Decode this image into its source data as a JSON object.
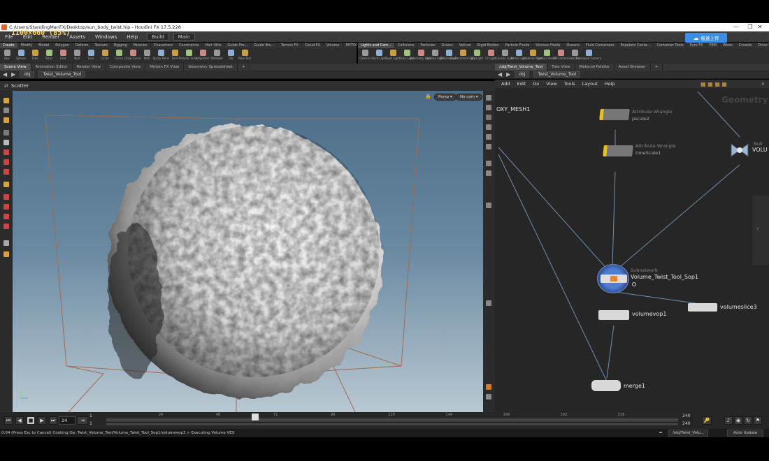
{
  "window": {
    "title": "C:/Users/StandingManFX/Desktop/sun_body_twist.hip - Houdini FX 17.5.228",
    "controls": [
      "—",
      "❐",
      "✕"
    ]
  },
  "overlay": {
    "size_label": "1100×660 (85%)"
  },
  "menubar": {
    "items": [
      "File",
      "Edit",
      "Render",
      "Assets",
      "Windows",
      "Help"
    ],
    "desktop_build": "Build",
    "desktop_main": "Main"
  },
  "cloud_button": {
    "label": "极速上传"
  },
  "shelf_left": {
    "tabs": [
      "Create",
      "Modify",
      "Model",
      "Polygon",
      "Deform",
      "Texture",
      "Rigging",
      "Muscles",
      "Characters",
      "Constraints",
      "Hair Utils",
      "Guide Pro...",
      "Guide Bru...",
      "Terrain FX",
      "Cloud FX",
      "Volume",
      "MYTOOLKIT"
    ],
    "tools": [
      "Box",
      "Sphere",
      "Tube",
      "Torus",
      "Grid",
      "Null",
      "Line",
      "Circle",
      "Curve",
      "Draw Curve",
      "Path",
      "Spray Paint",
      "Font",
      "Platonic Solids",
      "L-System",
      "Metaball",
      "File",
      "New Tool"
    ]
  },
  "shelf_right": {
    "tabs": [
      "Lights and Cam...",
      "Collisions",
      "Particles",
      "Grains",
      "Vellum",
      "Rigid Bodies",
      "Particle Fluids",
      "Viscous Fluids",
      "Oceans",
      "Fluid Containers",
      "Populate Conta...",
      "Container Tools",
      "Pyro FX",
      "FEM",
      "Wires",
      "Crowds",
      "Drive Simulation"
    ],
    "tools": [
      "Camera",
      "Point Light",
      "Spot Light",
      "Area Light",
      "Geometry Light",
      "Volume Light",
      "Distant Light",
      "Environment Light",
      "Sky Light",
      "GI Light",
      "Caustic Light",
      "Portal Light",
      "Ambient Light",
      "Stereo Camera",
      "VR Camera",
      "Switcher",
      "Gamepad Camera"
    ]
  },
  "left_panel": {
    "tabs": [
      "Scene View",
      "Animation Editor",
      "Render View",
      "Composite View",
      "Motion FX View",
      "Geometry Spreadsheet"
    ],
    "path_obj": "obj",
    "path_node": "Twist_Volume_Tool",
    "viewport_title": "Scatter",
    "persp": "Persp ▾",
    "cam": "No cam ▾"
  },
  "right_panel": {
    "tabs": [
      "/obj/Twist_Volume_Tool",
      "Tree View",
      "Material Palette",
      "Asset Browser"
    ],
    "path_obj": "obj",
    "path_node": "Twist_Volume_Tool",
    "menu": [
      "Add",
      "Edit",
      "Go",
      "View",
      "Tools",
      "Layout",
      "Help"
    ],
    "context_label": "Geometry",
    "nodes": {
      "proxy": "OXY_MESH1",
      "wrangle1_type": "Attribute Wrangle",
      "wrangle1_name": "pscale2",
      "wrangle2_type": "Attribute Wrangle",
      "wrangle2_name": "timeScale1",
      "null_type": "Null",
      "null_name": "VOLU",
      "subnet_type": "Subnetwork",
      "subnet_name": "Volume_Twist_Tool_Sop1",
      "vop": "volumevop1",
      "slice": "volumeslice3",
      "merge": "merge1"
    }
  },
  "timeline": {
    "current_frame": "24",
    "start": "1",
    "start2": "1",
    "end": "240",
    "end2": "240",
    "ticks": [
      "24",
      "48",
      "72",
      "96",
      "120",
      "144",
      "168",
      "192",
      "216"
    ]
  },
  "status": {
    "message": "0:04 (Press Esc to Cancel) Cooking Op: Twist_Volume_Tool/Volume_Twist_Tool_Sop1/volumevop3 > Executing Volume VEX",
    "path": "/obj/Twist_Volu...",
    "update": "Auto Update"
  },
  "colors": {
    "accent_blue": "#3a8ee6",
    "wrangle_yellow": "#e8c21e",
    "node_wire": "#6f8fb0"
  }
}
